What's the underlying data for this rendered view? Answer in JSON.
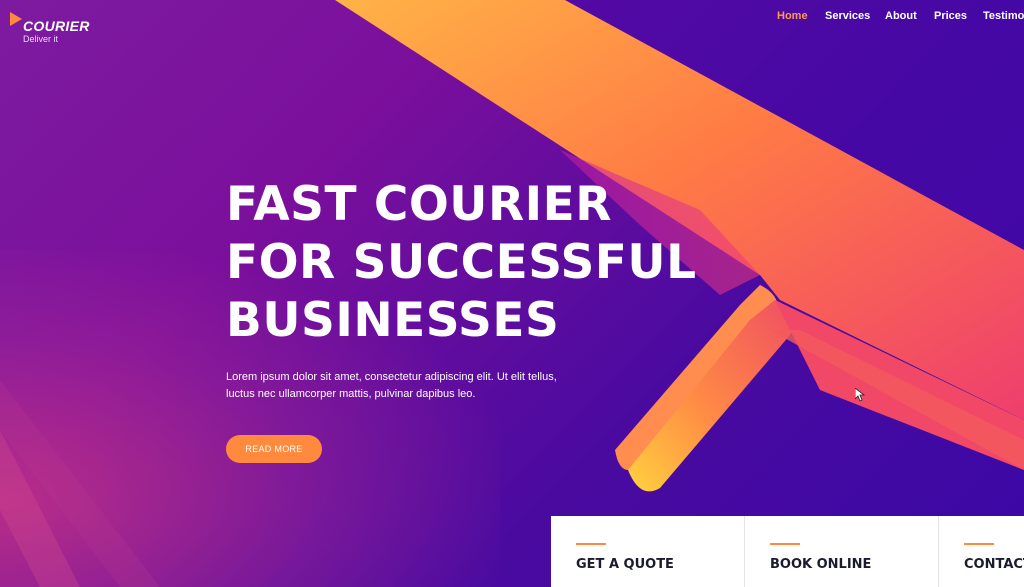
{
  "brand": {
    "name": "COURIER",
    "tagline": "Deliver it"
  },
  "nav": {
    "items": [
      {
        "label": "Home",
        "active": true
      },
      {
        "label": "Services",
        "active": false
      },
      {
        "label": "About",
        "active": false
      },
      {
        "label": "Prices",
        "active": false
      },
      {
        "label": "Testimonials",
        "active": false
      }
    ]
  },
  "hero": {
    "title_lines": [
      "FAST COURIER",
      "FOR SUCCESSFUL",
      "BUSINESSES"
    ],
    "text": "Lorem ipsum dolor sit amet, consectetur adipiscing elit. Ut elit tellus, luctus nec ullamcorper mattis, pulvinar dapibus leo.",
    "button_label": "READ MORE"
  },
  "cards": [
    {
      "label": "GET A QUOTE"
    },
    {
      "label": "BOOK ONLINE"
    },
    {
      "label": "CONTACT"
    }
  ],
  "colors": {
    "accent": "#ff8a3d",
    "nav_active": "#ff9a4d",
    "background_purple": "#6a0fa3",
    "arrow_yellow": "#ffc53d",
    "arrow_pink": "#f0416a",
    "card_text": "#1b1b2e"
  }
}
